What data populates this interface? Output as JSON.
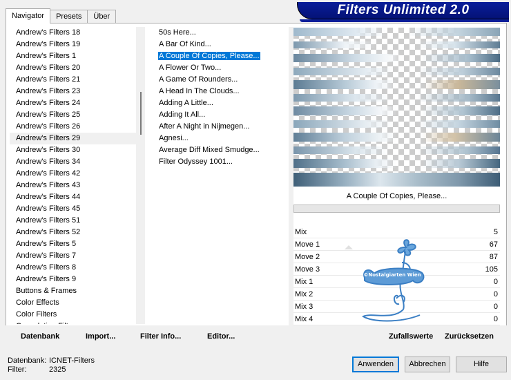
{
  "tabs": [
    "Navigator",
    "Presets",
    "Über"
  ],
  "title": "Filters Unlimited 2.0",
  "categories": [
    "Andrew's Filters 18",
    "Andrew's Filters 19",
    "Andrew's Filters 1",
    "Andrew's Filters 20",
    "Andrew's Filters 21",
    "Andrew's Filters 23",
    "Andrew's Filters 24",
    "Andrew's Filters 25",
    "Andrew's Filters 26",
    "Andrew's Filters 29",
    "Andrew's Filters 30",
    "Andrew's Filters 34",
    "Andrew's Filters 42",
    "Andrew's Filters 43",
    "Andrew's Filters 44",
    "Andrew's Filters 45",
    "Andrew's Filters 51",
    "Andrew's Filters 52",
    "Andrew's Filters 5",
    "Andrew's Filters 7",
    "Andrew's Filters 8",
    "Andrew's Filters 9",
    "Buttons & Frames",
    "Color Effects",
    "Color Filters",
    "Convolution Filters"
  ],
  "filters": [
    "50s Here...",
    "A Bar Of Kind...",
    "A Couple Of Copies, Please...",
    "A Flower Or Two...",
    "A Game Of Rounders...",
    "A Head In The Clouds...",
    "Adding A Little...",
    "Adding It All...",
    "After A Night in Nijmegen...",
    "Agnesi...",
    "Average Diff Mixed Smudge...",
    "Filter Odyssey 1001..."
  ],
  "selected_filter": "A Couple Of Copies, Please...",
  "preview_caption": "A Couple Of Copies, Please...",
  "params": [
    {
      "label": "Mix",
      "value": "5"
    },
    {
      "label": "Move 1",
      "value": "67"
    },
    {
      "label": "Move 2",
      "value": "87"
    },
    {
      "label": "Move 3",
      "value": "105"
    },
    {
      "label": "Mix 1",
      "value": "0"
    },
    {
      "label": "Mix 2",
      "value": "0"
    },
    {
      "label": "Mix 3",
      "value": "0"
    },
    {
      "label": "Mix 4",
      "value": "0"
    }
  ],
  "watermark": {
    "text": "©Nostalgiarten Wien"
  },
  "toolbar": {
    "datenbank": "Datenbank",
    "import": "Import...",
    "filter_info": "Filter Info...",
    "editor": "Editor...",
    "zufallswerte": "Zufallswerte",
    "zuruecksetzen": "Zurücksetzen"
  },
  "status": {
    "datenbank_label": "Datenbank:",
    "datenbank_value": "ICNET-Filters",
    "filter_label": "Filter:",
    "filter_value": "2325"
  },
  "buttons": {
    "apply": "Anwenden",
    "cancel": "Abbrechen",
    "help": "Hilfe"
  },
  "colors": {
    "title_bg": "#0a1e9a",
    "selection": "#0078d7"
  }
}
